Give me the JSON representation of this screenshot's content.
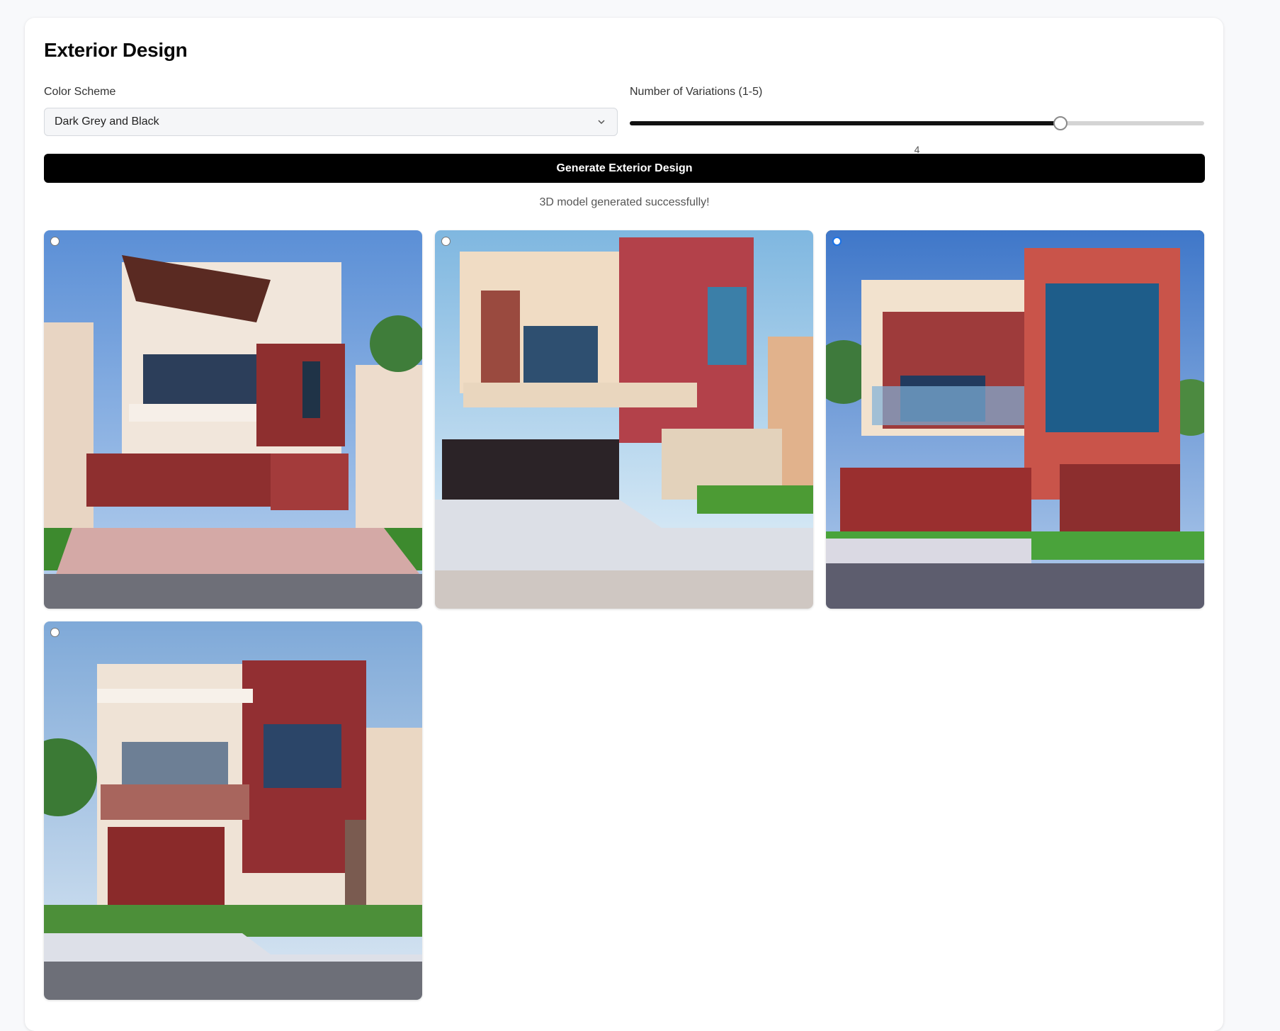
{
  "page": {
    "title": "Exterior Design",
    "color_scheme_label": "Color Scheme",
    "color_scheme_value": "Dark Grey and Black",
    "variations_label": "Number of Variations (1-5)",
    "variations_value": "4",
    "variations_min": 1,
    "variations_max": 5,
    "generate_button": "Generate Exterior Design",
    "status": "3D model generated successfully!"
  },
  "designs": [
    {
      "selected": false
    },
    {
      "selected": false
    },
    {
      "selected": true
    },
    {
      "selected": false
    }
  ],
  "colors": {
    "primary": "#000000",
    "selected_radio": "#1a73e8",
    "brick_red": "#8e2f2f"
  }
}
